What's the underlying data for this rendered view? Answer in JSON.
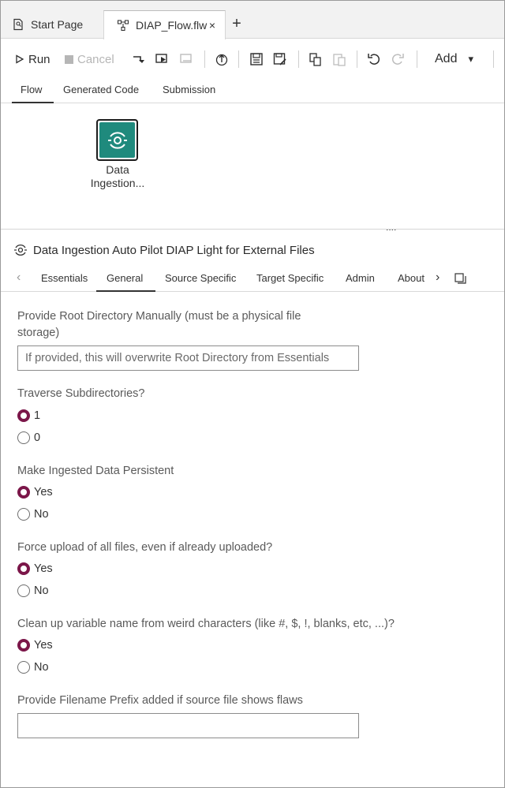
{
  "tabs": {
    "start": "Start Page",
    "active": "DIAP_Flow.flw",
    "close": "×",
    "add": "+"
  },
  "toolbar": {
    "run": "Run",
    "cancel": "Cancel",
    "add": "Add",
    "add_caret": "▾"
  },
  "flow_tabs": [
    "Flow",
    "Generated Code",
    "Submission"
  ],
  "canvas": {
    "node_label_line1": "Data",
    "node_label_line2": "Ingestion...",
    "grip": "...."
  },
  "panel": {
    "title": "Data Ingestion Auto Pilot DIAP Light for External Files",
    "tabs": [
      "Essentials",
      "General",
      "Source Specific",
      "Target Specific",
      "Admin",
      "About"
    ],
    "active_tab": "General"
  },
  "form": {
    "root_dir_label_1": "Provide Root Directory Manually (must be a physical file",
    "root_dir_label_2": "storage)",
    "root_dir_placeholder": "If provided, this will overwrite Root Directory from Essentials",
    "traverse_label": "Traverse Subdirectories?",
    "traverse_options": [
      "1",
      "0"
    ],
    "traverse_selected": "1",
    "persistent_label": "Make Ingested Data Persistent",
    "persistent_options": [
      "Yes",
      "No"
    ],
    "persistent_selected": "Yes",
    "force_label": "Force upload of all files, even if already uploaded?",
    "force_options": [
      "Yes",
      "No"
    ],
    "force_selected": "Yes",
    "cleanup_label": "Clean up variable name from weird characters (like #, $, !, blanks, etc, ...)?",
    "cleanup_options": [
      "Yes",
      "No"
    ],
    "cleanup_selected": "Yes",
    "prefix_label": "Provide Filename Prefix added if source file shows flaws",
    "prefix_value": ""
  },
  "colors": {
    "accent_radio": "#7b1649",
    "node_fill": "#1f8a7d"
  }
}
